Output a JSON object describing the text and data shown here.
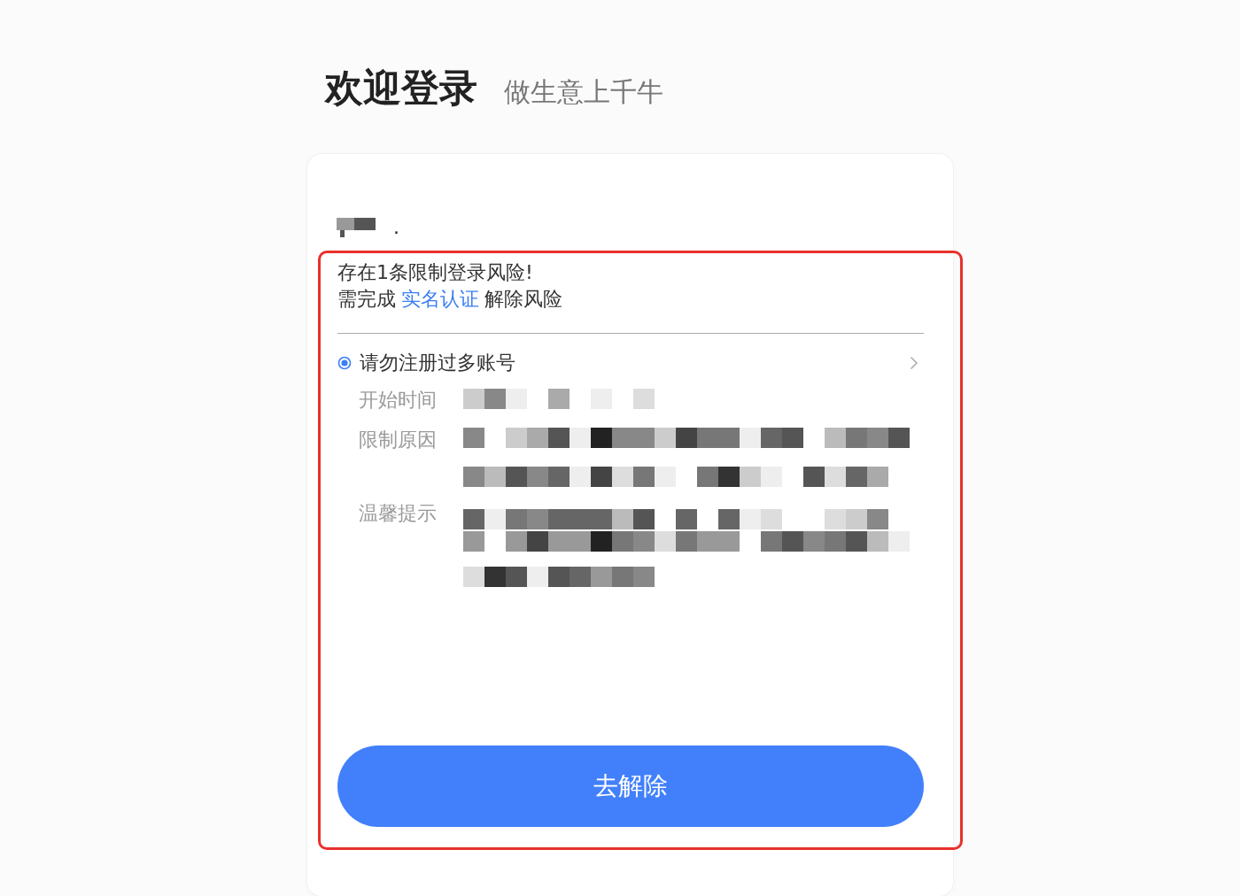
{
  "header": {
    "title": "欢迎登录",
    "subtitle": "做生意上千牛"
  },
  "account": {
    "visible_text": "."
  },
  "risk_notice": {
    "summary": "存在1条限制登录风险!",
    "instruction": {
      "before": "需完成",
      "link": "实名认证",
      "after": "解除风险"
    }
  },
  "restrictions": [
    {
      "title": "请勿注册过多账号",
      "selected": true,
      "fields": [
        {
          "label": "开始时间",
          "kind": "redacted"
        },
        {
          "label": "限制原因",
          "kind": "redacted"
        },
        {
          "label": "温馨提示",
          "kind": "redacted"
        }
      ]
    }
  ],
  "action_button": {
    "label": "去解除"
  }
}
